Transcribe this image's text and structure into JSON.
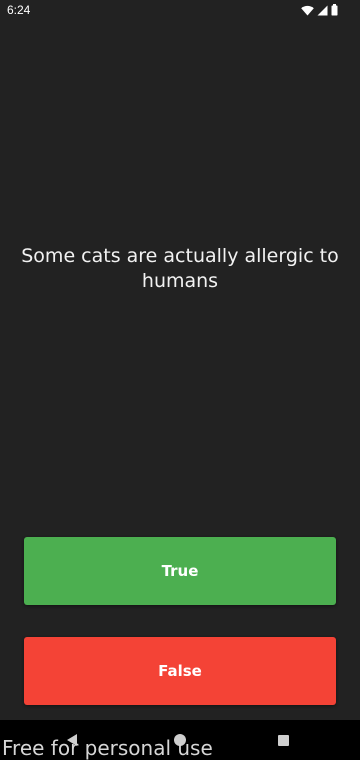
{
  "status_bar": {
    "time": "6:24",
    "icons": [
      "wifi-icon",
      "cell-signal-icon",
      "battery-icon"
    ]
  },
  "quiz": {
    "question": "Some cats are actually allergic to humans",
    "true_label": "True",
    "false_label": "False"
  },
  "colors": {
    "background": "#222222",
    "true_button": "#4caf50",
    "false_button": "#f44336",
    "nav_bar": "#000000"
  },
  "nav_bar": {
    "buttons": [
      "back-icon",
      "home-icon",
      "recents-icon"
    ]
  },
  "watermark": "Free for personal use"
}
